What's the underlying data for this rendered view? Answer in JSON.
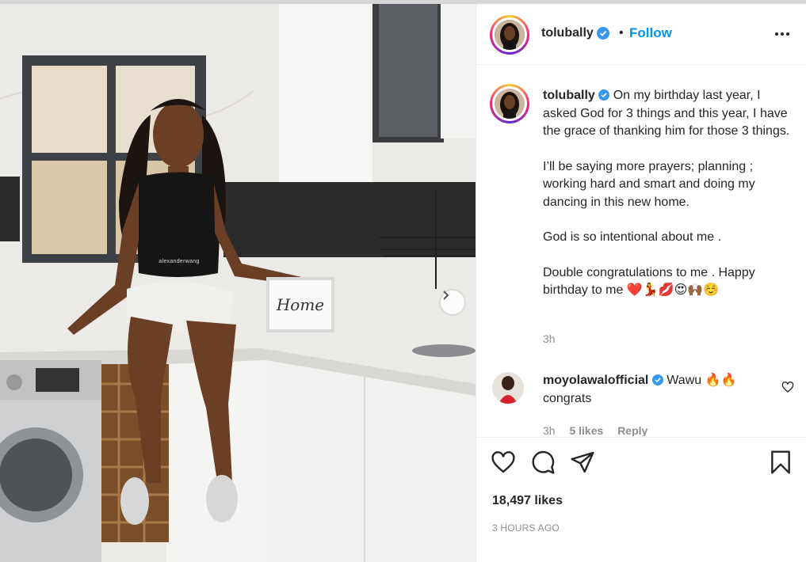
{
  "post": {
    "author": "tolubally",
    "follow_label": "Follow",
    "separator": "•",
    "caption_paragraphs": [
      "On my birthday last year, I asked God for 3 things and this year, I have the grace of thanking him for those 3 things.",
      "I’ll be saying more prayers; planning ; working hard and smart and doing my dancing in this new home.",
      "God is so intentional about me .",
      "Double congratulations to me . Happy birthday to me ❤️💃💋😍🙌🏾☺️"
    ],
    "caption_time": "3h",
    "likes_count": "18,497 likes",
    "posted_ago": "3 HOURS AGO"
  },
  "photo": {
    "sign_text": "Home",
    "waistband_text": "alexanderwang"
  },
  "comments": [
    {
      "author": "moyolawalofficial",
      "text": "Wawu 🔥🔥 congrats",
      "time": "3h",
      "likes": "5 likes",
      "reply_label": "Reply"
    }
  ],
  "icons": {
    "verified": "verified-badge-icon",
    "more": "more-options-icon",
    "like": "heart-icon",
    "comment": "comment-icon",
    "share": "share-icon",
    "save": "bookmark-icon",
    "next": "chevron-right-icon"
  },
  "colors": {
    "follow_blue": "#0095f6",
    "verified_blue": "#3897f0",
    "text": "#262626",
    "secondary": "#8e8e8e"
  }
}
